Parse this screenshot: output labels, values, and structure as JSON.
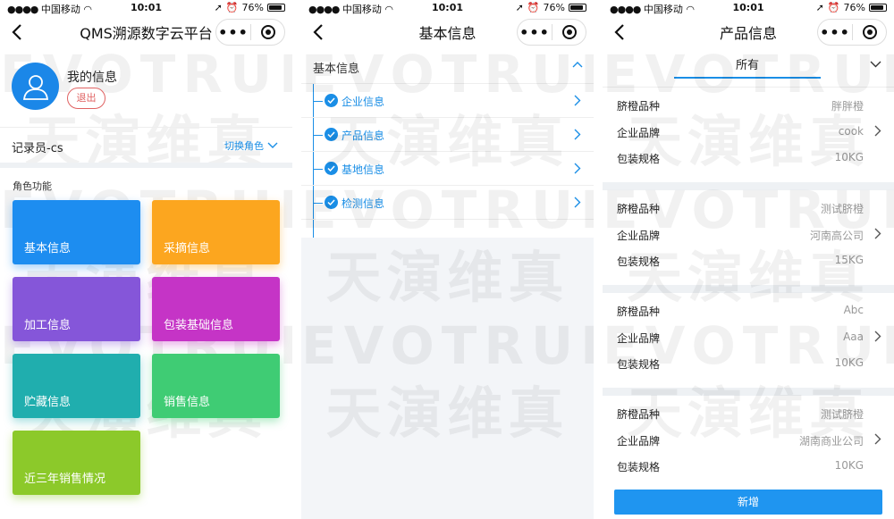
{
  "status": {
    "carrier": "中国移动",
    "time": "10:01",
    "battery": "76%",
    "battery_level": 0.76
  },
  "watermark": {
    "en": "EVOTRUE",
    "cn": "天演维真"
  },
  "panel1": {
    "title": "QMS溯源数字云平台",
    "profile_name": "我的信息",
    "logout_label": "退出",
    "role": "记录员-cs",
    "switch_role": "切换角色",
    "section_label": "角色功能",
    "tiles": [
      {
        "label": "基本信息",
        "color": "#1d8df0"
      },
      {
        "label": "采摘信息",
        "color": "#fca61f"
      },
      {
        "label": "加工信息",
        "color": "#8556d9"
      },
      {
        "label": "包装基础信息",
        "color": "#c534c6"
      },
      {
        "label": "贮藏信息",
        "color": "#20aeae"
      },
      {
        "label": "销售信息",
        "color": "#3fcc74"
      },
      {
        "label": "近三年销售情况",
        "color": "#8cc92a"
      }
    ]
  },
  "panel2": {
    "title": "基本信息",
    "section": "基本信息",
    "items": [
      "企业信息",
      "产品信息",
      "基地信息",
      "检测信息"
    ]
  },
  "panel3": {
    "title": "产品信息",
    "filter_value": "所有",
    "labels": {
      "variety": "脐橙品种",
      "brand": "企业品牌",
      "spec": "包装规格"
    },
    "products": [
      {
        "variety": "胖胖橙",
        "brand": "cook",
        "spec": "10KG"
      },
      {
        "variety": "测试脐橙",
        "brand": "河南高公司",
        "spec": "15KG"
      },
      {
        "variety": "Abc",
        "brand": "Aaa",
        "spec": "10KG"
      },
      {
        "variety": "测试脐橙",
        "brand": "湖南商业公司",
        "spec": "10KG"
      }
    ],
    "add_label": "新增"
  },
  "colors": {
    "accent": "#1a8ee6",
    "logout": "#e06262"
  }
}
